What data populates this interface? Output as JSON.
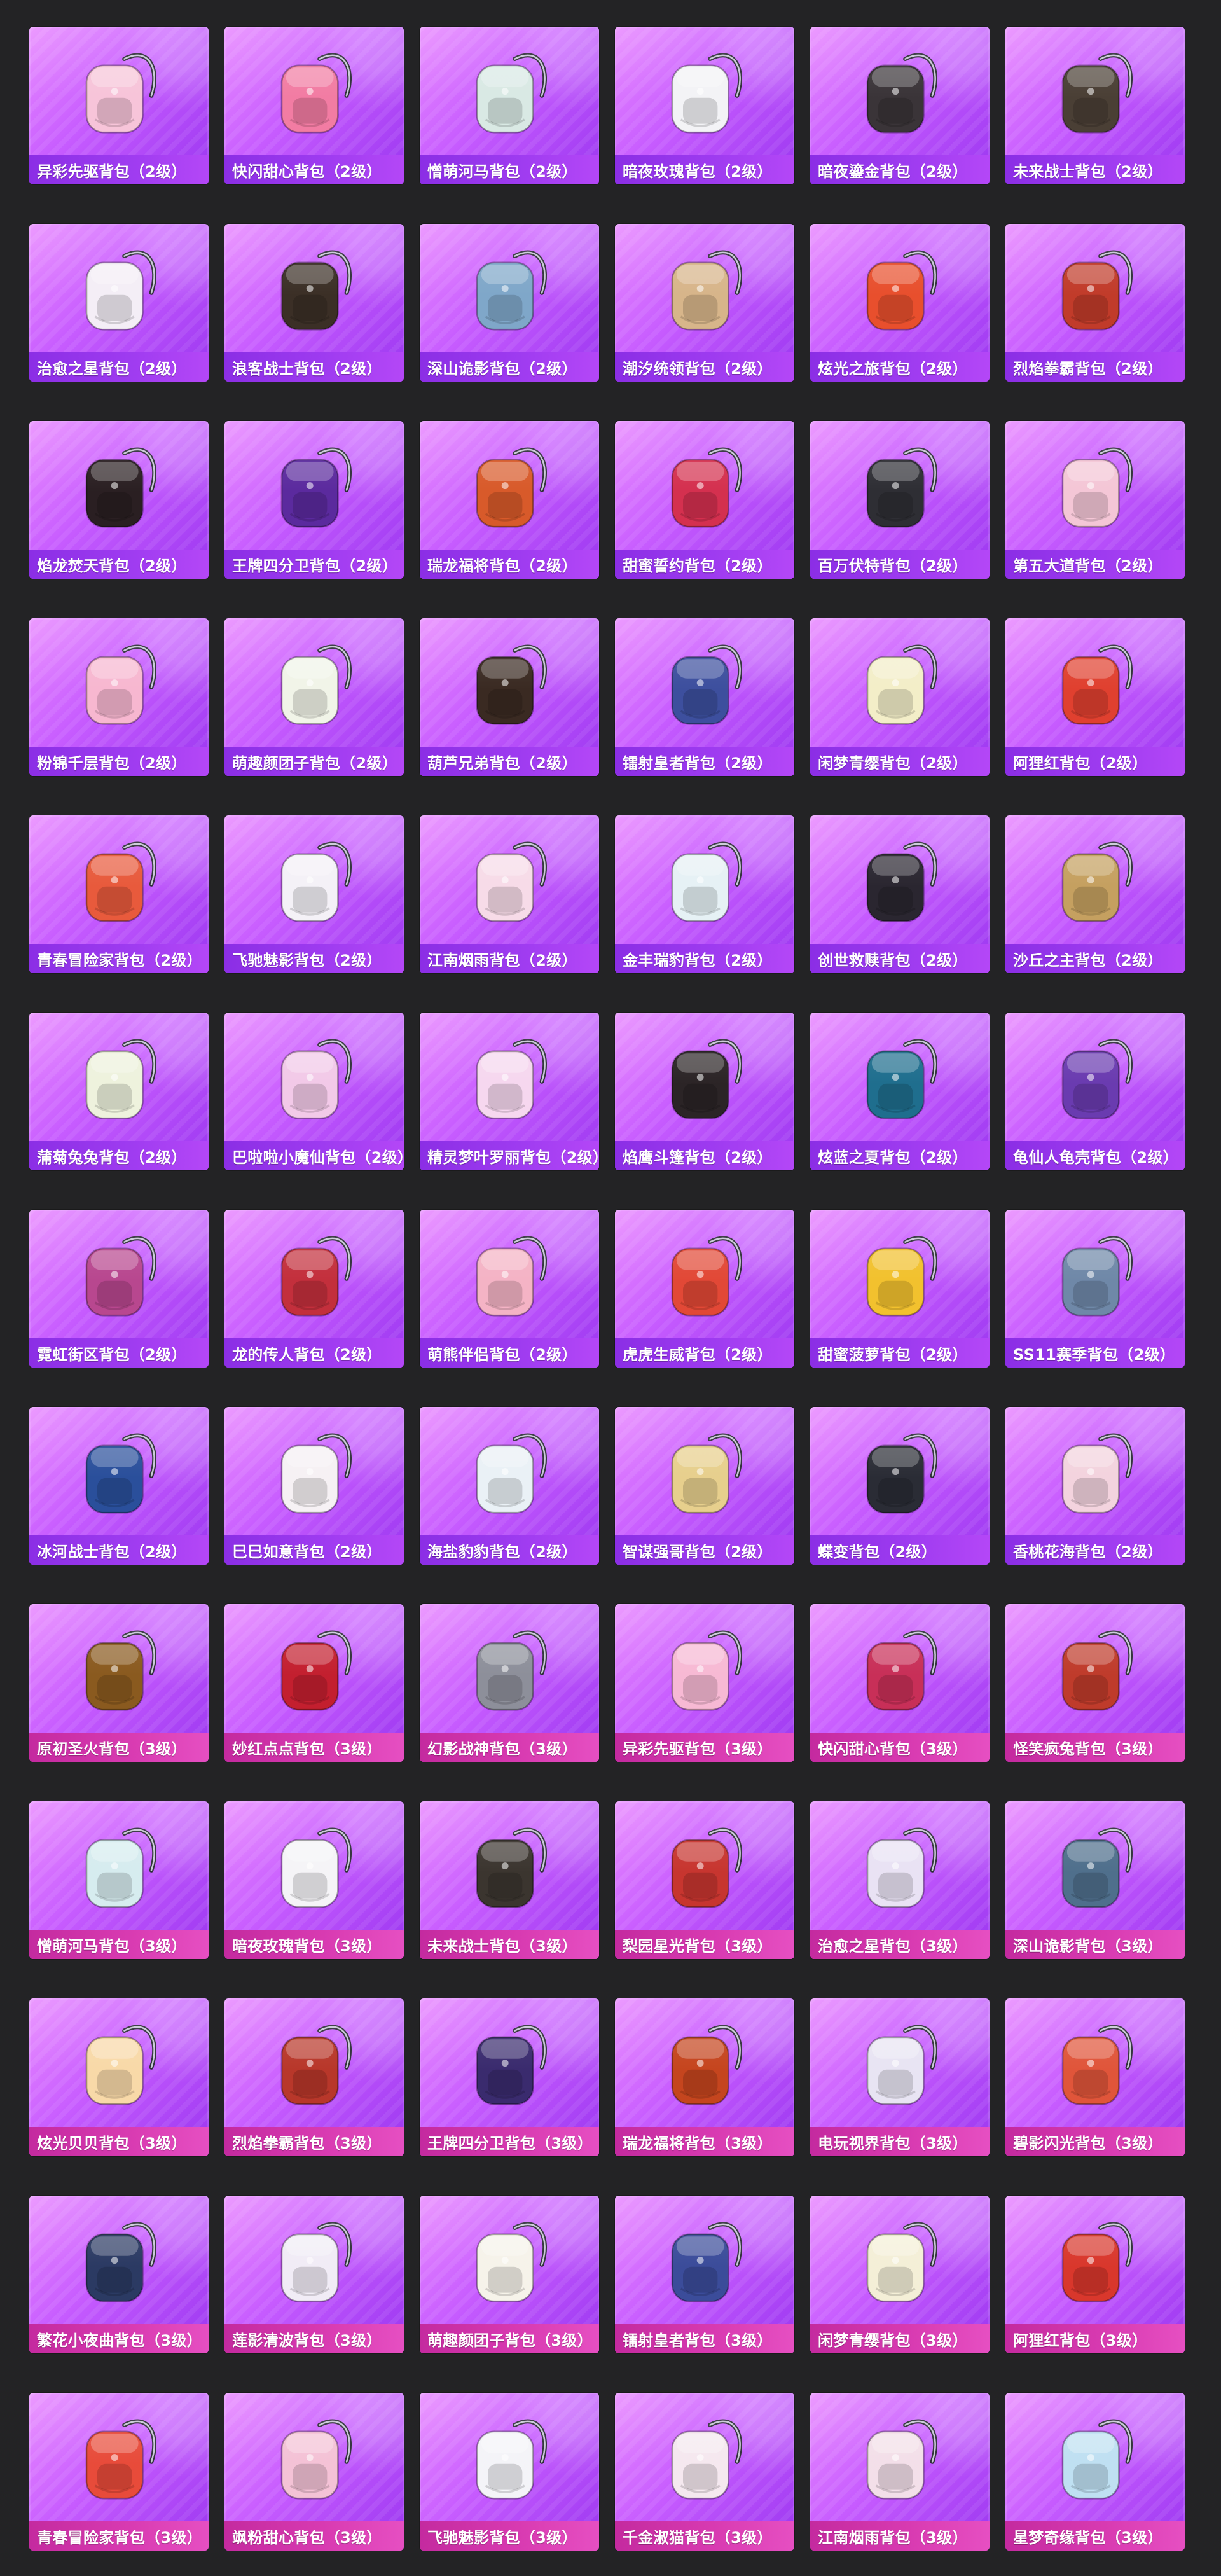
{
  "items": [
    {
      "name": "异彩先驱背包（2级）",
      "icon": "backpack-icon",
      "color": "#f7c4d9"
    },
    {
      "name": "快闪甜心背包（2级）",
      "icon": "backpack-icon",
      "color": "#f27ca3"
    },
    {
      "name": "憎萌河马背包（2级）",
      "icon": "backpack-icon",
      "color": "#d9e9e4"
    },
    {
      "name": "暗夜玫瑰背包（2级）",
      "icon": "backpack-icon",
      "color": "#f3f3f6"
    },
    {
      "name": "暗夜鎏金背包（2级）",
      "icon": "backpack-icon",
      "color": "#3a3438"
    },
    {
      "name": "未来战士背包（2级）",
      "icon": "backpack-icon",
      "color": "#4a3f35"
    },
    {
      "name": "治愈之星背包（2级）",
      "icon": "backpack-icon",
      "color": "#f4eef6"
    },
    {
      "name": "浪客战士背包（2级）",
      "icon": "backpack-icon",
      "color": "#3b2f26"
    },
    {
      "name": "深山诡影背包（2级）",
      "icon": "backpack-icon",
      "color": "#7fa7c9"
    },
    {
      "name": "潮汐统领背包（2级）",
      "icon": "backpack-icon",
      "color": "#d7b58a"
    },
    {
      "name": "炫光之旅背包（2级）",
      "icon": "backpack-icon",
      "color": "#e84f2d"
    },
    {
      "name": "烈焰拳霸背包（2级）",
      "icon": "backpack-icon",
      "color": "#c13b2a"
    },
    {
      "name": "焰龙焚天背包（2级）",
      "icon": "backpack-icon",
      "color": "#2a1f22"
    },
    {
      "name": "王牌四分卫背包（2级）",
      "icon": "backpack-icon",
      "color": "#5b2a9e"
    },
    {
      "name": "瑞龙福将背包（2级）",
      "icon": "backpack-icon",
      "color": "#d85a2a"
    },
    {
      "name": "甜蜜誓约背包（2级）",
      "icon": "backpack-icon",
      "color": "#d4304f"
    },
    {
      "name": "百万伏特背包（2级）",
      "icon": "backpack-icon",
      "color": "#2e2e34"
    },
    {
      "name": "第五大道背包（2级）",
      "icon": "backpack-icon",
      "color": "#f4c6d6"
    },
    {
      "name": "粉锦千层背包（2级）",
      "icon": "backpack-icon",
      "color": "#f7b7d0"
    },
    {
      "name": "萌趣颜团子背包（2级）",
      "icon": "backpack-icon",
      "color": "#f1f4e8"
    },
    {
      "name": "葫芦兄弟背包（2级）",
      "icon": "backpack-icon",
      "color": "#3a2a22"
    },
    {
      "name": "镭射皇者背包（2级）",
      "icon": "backpack-icon",
      "color": "#3d4f9e"
    },
    {
      "name": "闲梦青缨背包（2级）",
      "icon": "backpack-icon",
      "color": "#f3eec8"
    },
    {
      "name": "阿狸红背包（2级）",
      "icon": "backpack-icon",
      "color": "#e0402f"
    },
    {
      "name": "青春冒险家背包（2级）",
      "icon": "backpack-icon",
      "color": "#e85a3c"
    },
    {
      "name": "飞驰魅影背包（2级）",
      "icon": "backpack-icon",
      "color": "#f4f1f7"
    },
    {
      "name": "江南烟雨背包（2级）",
      "icon": "backpack-icon",
      "color": "#f7dbe8"
    },
    {
      "name": "金丰瑞豹背包（2级）",
      "icon": "backpack-icon",
      "color": "#e6f1f5"
    },
    {
      "name": "创世救赎背包（2级）",
      "icon": "backpack-icon",
      "color": "#2a2630"
    },
    {
      "name": "沙丘之主背包（2级）",
      "icon": "backpack-icon",
      "color": "#c5a060"
    },
    {
      "name": "蒲菊兔兔背包（2级）",
      "icon": "backpack-icon",
      "color": "#eef2dd"
    },
    {
      "name": "巴啦啦小魔仙背包（2级）",
      "icon": "backpack-icon",
      "color": "#f2c9e8"
    },
    {
      "name": "精灵梦叶罗丽背包（2级）",
      "icon": "backpack-icon",
      "color": "#f6d7ef"
    },
    {
      "name": "焰鹰斗篷背包（2级）",
      "icon": "backpack-icon",
      "color": "#2b2426"
    },
    {
      "name": "炫蓝之夏背包（2级）",
      "icon": "backpack-icon",
      "color": "#1f6e8e"
    },
    {
      "name": "龟仙人龟壳背包（2级）",
      "icon": "backpack-icon",
      "color": "#6a3bb0"
    },
    {
      "name": "霓虹街区背包（2级）",
      "icon": "backpack-icon",
      "color": "#b8478f"
    },
    {
      "name": "龙的传人背包（2级）",
      "icon": "backpack-icon",
      "color": "#c32f3c"
    },
    {
      "name": "萌熊伴侣背包（2级）",
      "icon": "backpack-icon",
      "color": "#f4b3c5"
    },
    {
      "name": "虎虎生威背包（2级）",
      "icon": "backpack-icon",
      "color": "#e24836"
    },
    {
      "name": "甜蜜菠萝背包（2级）",
      "icon": "backpack-icon",
      "color": "#f2c12e"
    },
    {
      "name": "SS11赛季背包（2级）",
      "icon": "backpack-icon",
      "color": "#6f88a8"
    },
    {
      "name": "冰河战士背包（2级）",
      "icon": "backpack-icon",
      "color": "#2a4f9b"
    },
    {
      "name": "巳巳如意背包（2级）",
      "icon": "backpack-icon",
      "color": "#f6f1f4"
    },
    {
      "name": "海盐豹豹背包（2级）",
      "icon": "backpack-icon",
      "color": "#eaf1f6"
    },
    {
      "name": "智谋强哥背包（2级）",
      "icon": "backpack-icon",
      "color": "#e7cf8d"
    },
    {
      "name": "蝶变背包（2级）",
      "icon": "backpack-icon",
      "color": "#2a2c35"
    },
    {
      "name": "香桃花海背包（2级）",
      "icon": "backpack-icon",
      "color": "#f3d3de"
    },
    {
      "name": "原初圣火背包（3级）",
      "icon": "backpack-icon",
      "color": "#8a5a1f"
    },
    {
      "name": "妙红点点背包（3级）",
      "icon": "backpack-icon",
      "color": "#c31f2f"
    },
    {
      "name": "幻影战神背包（3级）",
      "icon": "backpack-icon",
      "color": "#8d8f9a"
    },
    {
      "name": "异彩先驱背包（3级）",
      "icon": "backpack-icon",
      "color": "#f7b9d4"
    },
    {
      "name": "快闪甜心背包（3级）",
      "icon": "backpack-icon",
      "color": "#c82f58"
    },
    {
      "name": "怪笑疯兔背包（3级）",
      "icon": "backpack-icon",
      "color": "#bf3b2b"
    },
    {
      "name": "憎萌河马背包（3级）",
      "icon": "backpack-icon",
      "color": "#d6ecef"
    },
    {
      "name": "暗夜玫瑰背包（3级）",
      "icon": "backpack-icon",
      "color": "#f5f4f7"
    },
    {
      "name": "未来战士背包（3级）",
      "icon": "backpack-icon",
      "color": "#3b352f"
    },
    {
      "name": "梨园星光背包（3级）",
      "icon": "backpack-icon",
      "color": "#c7352f"
    },
    {
      "name": "治愈之星背包（3级）",
      "icon": "backpack-icon",
      "color": "#e9e2f4"
    },
    {
      "name": "深山诡影背包（3级）",
      "icon": "backpack-icon",
      "color": "#4f6f8c"
    },
    {
      "name": "炫光贝贝背包（3级）",
      "icon": "backpack-icon",
      "color": "#f8d9a8"
    },
    {
      "name": "烈焰拳霸背包（3级）",
      "icon": "backpack-icon",
      "color": "#b8372a"
    },
    {
      "name": "王牌四分卫背包（3级）",
      "icon": "backpack-icon",
      "color": "#3a2b6e"
    },
    {
      "name": "瑞龙福将背包（3级）",
      "icon": "backpack-icon",
      "color": "#c5451e"
    },
    {
      "name": "电玩视界背包（3级）",
      "icon": "backpack-icon",
      "color": "#e8e4f3"
    },
    {
      "name": "碧影闪光背包（3级）",
      "icon": "backpack-icon",
      "color": "#e0553a"
    },
    {
      "name": "繁花小夜曲背包（3级）",
      "icon": "backpack-icon",
      "color": "#2b3a63"
    },
    {
      "name": "莲影清波背包（3级）",
      "icon": "backpack-icon",
      "color": "#f1ecf6"
    },
    {
      "name": "萌趣颜团子背包（3级）",
      "icon": "backpack-icon",
      "color": "#f6f3ea"
    },
    {
      "name": "镭射皇者背包（3级）",
      "icon": "backpack-icon",
      "color": "#3b4c9a"
    },
    {
      "name": "闲梦青缨背包（3级）",
      "icon": "backpack-icon",
      "color": "#f4efd7"
    },
    {
      "name": "阿狸红背包（3级）",
      "icon": "backpack-icon",
      "color": "#d9372c"
    },
    {
      "name": "青春冒险家背包（3级）",
      "icon": "backpack-icon",
      "color": "#e84b3a"
    },
    {
      "name": "飒粉甜心背包（3级）",
      "icon": "backpack-icon",
      "color": "#f4c2d6"
    },
    {
      "name": "飞驰魅影背包（3级）",
      "icon": "backpack-icon",
      "color": "#f4f4f8"
    },
    {
      "name": "千金淑猫背包（3级）",
      "icon": "backpack-icon",
      "color": "#f5e8ef"
    },
    {
      "name": "江南烟雨背包（3级）",
      "icon": "backpack-icon",
      "color": "#f3dfe9"
    },
    {
      "name": "星梦奇缘背包（3级）",
      "icon": "backpack-icon",
      "color": "#bfe0f2"
    }
  ]
}
